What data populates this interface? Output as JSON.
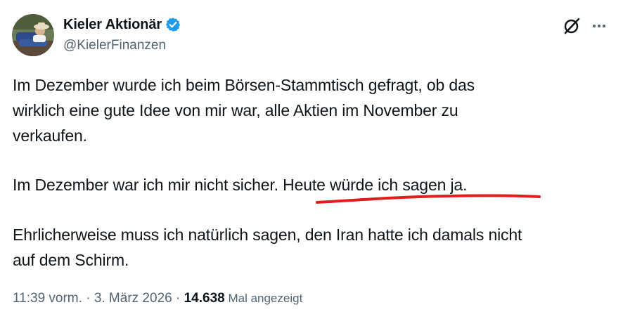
{
  "author": {
    "display_name": "Kieler Aktionär",
    "handle": "@KielerFinanzen",
    "verified": true
  },
  "icons": {
    "verified": "verified-badge-icon",
    "grok": "grok-icon",
    "more": "more-options-icon"
  },
  "colors": {
    "verified_blue": "#1d9bf0",
    "text": "#0f1419",
    "secondary": "#536471",
    "annotation": "#e0201f"
  },
  "tweet": {
    "paragraph_1_line_1": "Im Dezember wurde ich beim Börsen-Stammtisch gefragt, ob das",
    "paragraph_1_line_2": "wirklich eine gute Idee von mir war, alle Aktien im November zu",
    "paragraph_1_line_3": "verkaufen.",
    "paragraph_2_start": "Im Dezember war ich mir nicht sicher. ",
    "paragraph_2_highlight": "Heute würde ich sagen ja.",
    "paragraph_3_line_1": "Ehrlicherweise muss ich natürlich sagen, den Iran hatte ich damals nicht",
    "paragraph_3_line_2": "auf dem Schirm."
  },
  "meta": {
    "time": "11:39 vorm.",
    "separator_1": " · ",
    "date": "3. März 2026",
    "separator_2": " · ",
    "views_count": "14.638",
    "views_label": " Mal angezeigt"
  }
}
